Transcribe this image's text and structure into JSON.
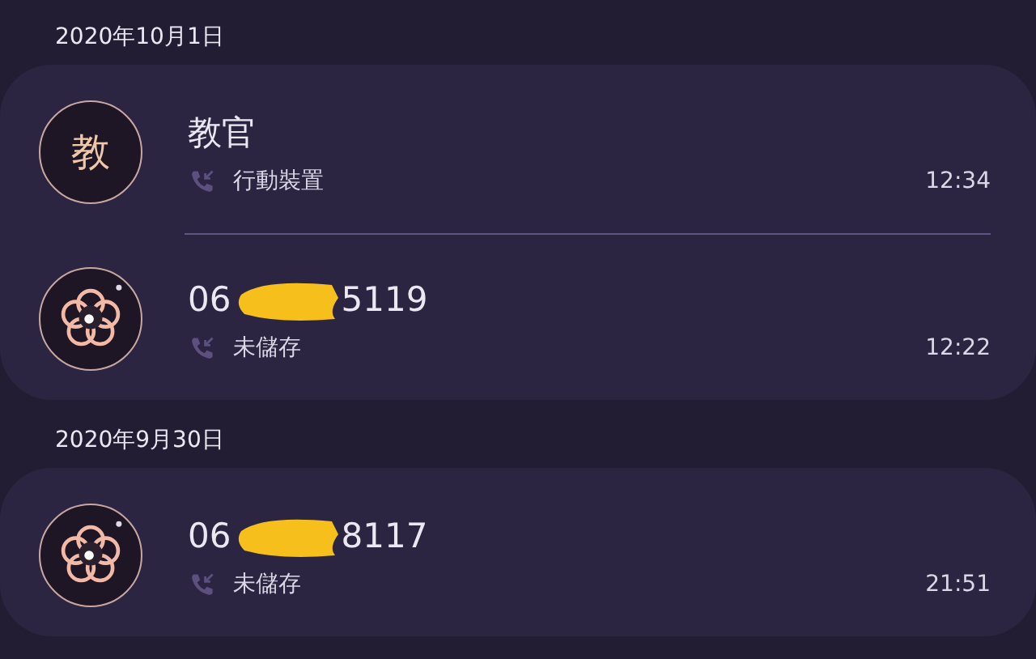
{
  "groups": [
    {
      "date": "2020年10月1日",
      "calls": [
        {
          "avatar": {
            "kind": "letter",
            "text": "教"
          },
          "name_parts": [
            "教官"
          ],
          "redacted": false,
          "type": "行動裝置",
          "time": "12:34"
        },
        {
          "avatar": {
            "kind": "flower"
          },
          "name_parts": [
            "06",
            "5119"
          ],
          "redacted": true,
          "type": "未儲存",
          "time": "12:22"
        }
      ]
    },
    {
      "date": "2020年9月30日",
      "calls": [
        {
          "avatar": {
            "kind": "flower"
          },
          "name_parts": [
            "06",
            "8117"
          ],
          "redacted": true,
          "type": "未儲存",
          "time": "21:51"
        }
      ]
    }
  ]
}
